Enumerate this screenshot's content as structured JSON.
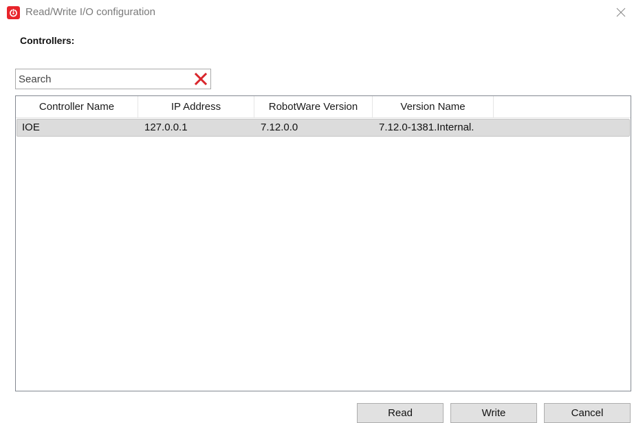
{
  "window": {
    "title": "Read/Write I/O configuration",
    "app_icon": "abb-robot-icon",
    "close_icon": "close-icon",
    "accent_color": "#e8242b"
  },
  "controllers": {
    "label": "Controllers:"
  },
  "search": {
    "value": "",
    "placeholder": "Search",
    "clear_icon": "red-x-icon"
  },
  "grid": {
    "columns": [
      "Controller Name",
      "IP Address",
      "RobotWare Version",
      "Version Name"
    ],
    "rows": [
      {
        "controller_name": "IOE",
        "ip_address": "127.0.0.1",
        "robotware_version": "7.12.0.0",
        "version_name": "7.12.0-1381.Internal.",
        "selected": true
      }
    ]
  },
  "buttons": {
    "read": "Read",
    "write": "Write",
    "cancel": "Cancel"
  }
}
